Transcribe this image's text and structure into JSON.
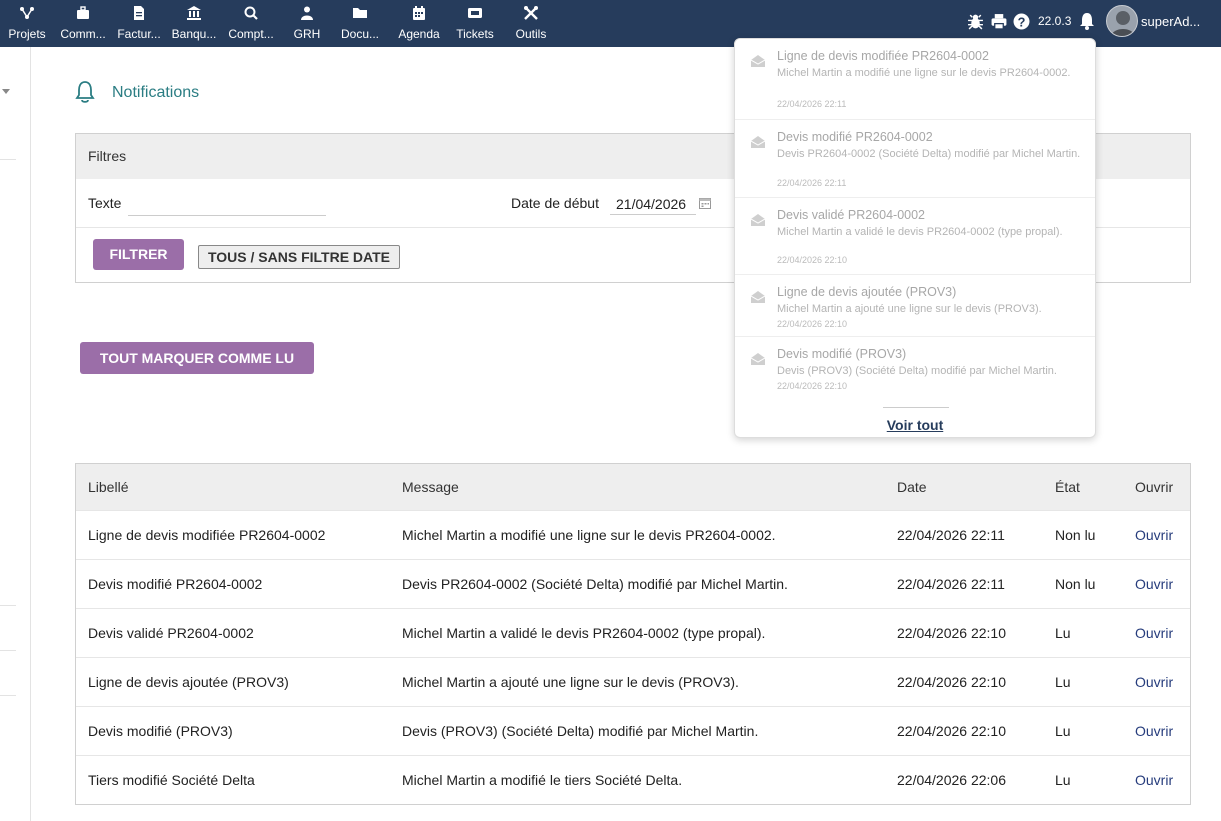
{
  "topbar": {
    "menu": [
      {
        "label": "Projets",
        "icon": "projects-icon"
      },
      {
        "label": "Comm...",
        "icon": "briefcase-icon"
      },
      {
        "label": "Factur...",
        "icon": "invoice-icon"
      },
      {
        "label": "Banqu...",
        "icon": "bank-icon"
      },
      {
        "label": "Compt...",
        "icon": "accounting-search-icon"
      },
      {
        "label": "GRH",
        "icon": "user-icon"
      },
      {
        "label": "Docu...",
        "icon": "folder-icon"
      },
      {
        "label": "Agenda",
        "icon": "calendar-icon"
      },
      {
        "label": "Tickets",
        "icon": "ticket-icon"
      },
      {
        "label": "Outils",
        "icon": "tools-icon"
      }
    ],
    "version": "22.0.3",
    "username": "superAd...",
    "colors": {
      "bar": "#263c5c",
      "accent": "#9b6ea8",
      "title": "#2b7d83"
    }
  },
  "page": {
    "title": "Notifications"
  },
  "filters": {
    "header": "Filtres",
    "text_label": "Texte",
    "text_value": "",
    "date_label": "Date de début",
    "date_value": "21/04/2026",
    "filter_button": "FILTRER",
    "all_button": "TOUS / SANS FILTRE DATE"
  },
  "mark_all_button": "TOUT MARQUER COMME LU",
  "table": {
    "headers": [
      "Libellé",
      "Message",
      "Date",
      "État",
      "Ouvrir"
    ],
    "rows": [
      {
        "libelle": "Ligne de devis modifiée PR2604-0002",
        "message": "Michel Martin a modifié une ligne sur le devis PR2604-0002.",
        "date": "22/04/2026 22:11",
        "etat": "Non lu",
        "ouvrir": "Ouvrir"
      },
      {
        "libelle": "Devis modifié PR2604-0002",
        "message": "Devis PR2604-0002 (Société Delta) modifié par Michel Martin.",
        "date": "22/04/2026 22:11",
        "etat": "Non lu",
        "ouvrir": "Ouvrir"
      },
      {
        "libelle": "Devis validé PR2604-0002",
        "message": "Michel Martin a validé le devis PR2604-0002 (type propal).",
        "date": "22/04/2026 22:10",
        "etat": "Lu",
        "ouvrir": "Ouvrir"
      },
      {
        "libelle": "Ligne de devis ajoutée (PROV3)",
        "message": "Michel Martin a ajouté une ligne sur le devis (PROV3).",
        "date": "22/04/2026 22:10",
        "etat": "Lu",
        "ouvrir": "Ouvrir"
      },
      {
        "libelle": "Devis modifié (PROV3)",
        "message": "Devis (PROV3) (Société Delta) modifié par Michel Martin.",
        "date": "22/04/2026 22:10",
        "etat": "Lu",
        "ouvrir": "Ouvrir"
      },
      {
        "libelle": "Tiers modifié Société Delta",
        "message": "Michel Martin a modifié le tiers Société Delta.",
        "date": "22/04/2026 22:06",
        "etat": "Lu",
        "ouvrir": "Ouvrir"
      }
    ]
  },
  "dropdown": {
    "items": [
      {
        "title": "Ligne de devis modifiée PR2604-0002",
        "message": "Michel Martin a modifié une ligne sur le devis PR2604-0002.",
        "date": "22/04/2026 22:11"
      },
      {
        "title": "Devis modifié PR2604-0002",
        "message": "Devis PR2604-0002 (Société Delta) modifié par Michel Martin.",
        "date": "22/04/2026 22:11"
      },
      {
        "title": "Devis validé PR2604-0002",
        "message": "Michel Martin a validé le devis PR2604-0002 (type propal).",
        "date": "22/04/2026 22:10"
      },
      {
        "title": "Ligne de devis ajoutée (PROV3)",
        "message": "Michel Martin a ajouté une ligne sur le devis (PROV3).",
        "date": "22/04/2026 22:10"
      },
      {
        "title": "Devis modifié (PROV3)",
        "message": "Devis (PROV3) (Société Delta) modifié par Michel Martin.",
        "date": "22/04/2026 22:10"
      }
    ],
    "see_all": "Voir tout"
  }
}
